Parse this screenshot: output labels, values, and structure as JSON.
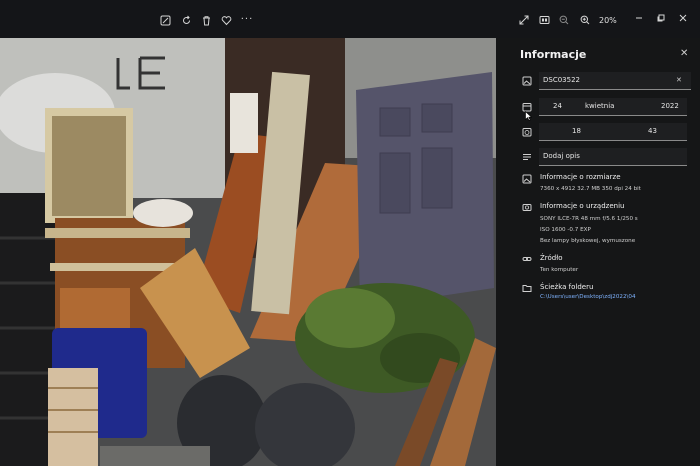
{
  "toolbar": {
    "icons_left": [
      "edit-icon",
      "rotate-icon",
      "delete-icon",
      "heart-icon",
      "more-icon"
    ],
    "icons_right": [
      "fullscreen-icon",
      "film-icon",
      "zoom-out-icon",
      "zoom-in-icon"
    ],
    "zoom": "20%",
    "window": [
      "minimize-icon",
      "maximize-icon",
      "close-icon"
    ]
  },
  "panel": {
    "title": "Informacje",
    "filename": "DSC03522",
    "date": {
      "day": "24",
      "month": "kwietnia",
      "year": "2022"
    },
    "time": {
      "hour": "18",
      "minute": "43"
    },
    "description_placeholder": "Dodaj opis",
    "size": {
      "heading": "Informacje o rozmiarze",
      "details": "7360 x 4912   32.7 MB   350 dpi   24 bit"
    },
    "device": {
      "heading": "Informacje o urządzeniu",
      "line1": "SONY   ILCE-7R   48 mm   f/5.6   1/250 s",
      "line2": "ISO 1600   -0.7 EXP",
      "line3": "Bez lampy błyskowej, wymuszone"
    },
    "source": {
      "heading": "Źródło",
      "value": "Ten komputer"
    },
    "folder": {
      "heading": "Ścieżka folderu",
      "value": "C:\\Users\\user\\Desktop\\zdj2022\\04"
    }
  }
}
